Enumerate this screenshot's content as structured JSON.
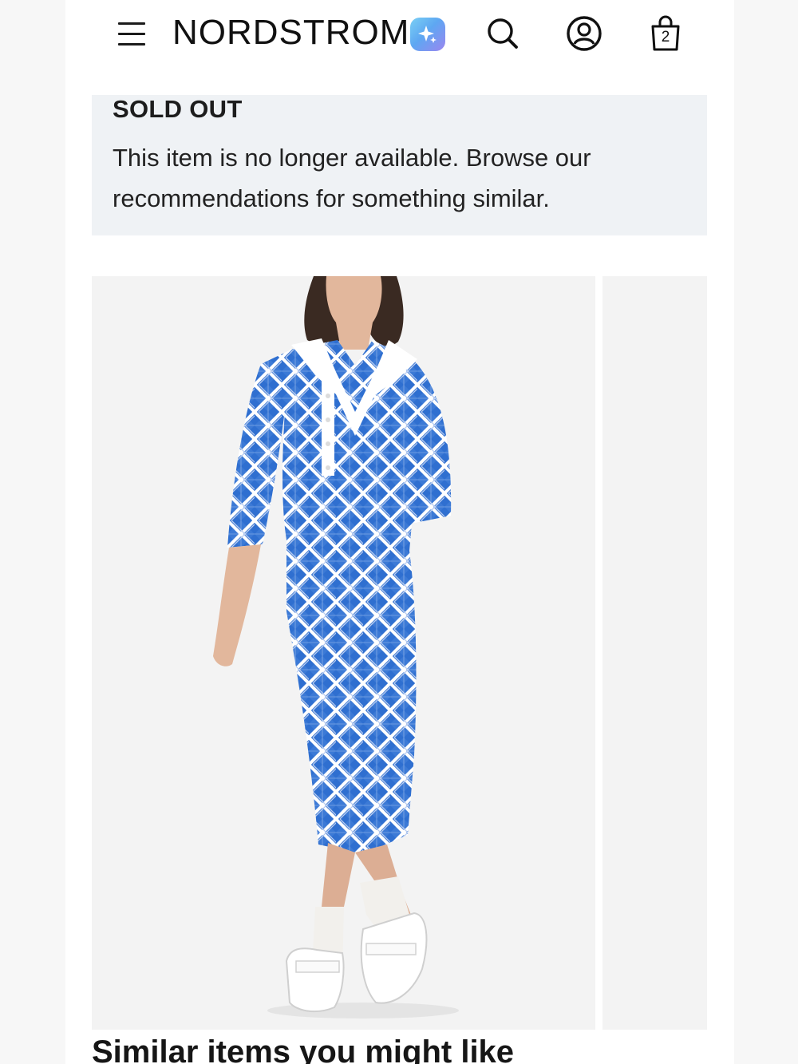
{
  "header": {
    "logo": "NORDSTROM",
    "menu_icon": "hamburger-menu-icon",
    "ai_icon": "sparkle-icon",
    "search_icon": "search-icon",
    "account_icon": "account-icon",
    "bag_icon": "shopping-bag-icon",
    "bag_count": "2"
  },
  "banner": {
    "title": "SOLD OUT",
    "message": "This item is no longer available. Browse our recommendations for something similar."
  },
  "product": {
    "image_alt": "Model wearing blue argyle polo midi dress with white socks and sandals",
    "colors": {
      "primary_blue": "#2f6fd0",
      "light_blue": "#b9cdf0",
      "background": "#f3f3f3"
    }
  },
  "similar": {
    "heading": "Similar items you might like"
  }
}
